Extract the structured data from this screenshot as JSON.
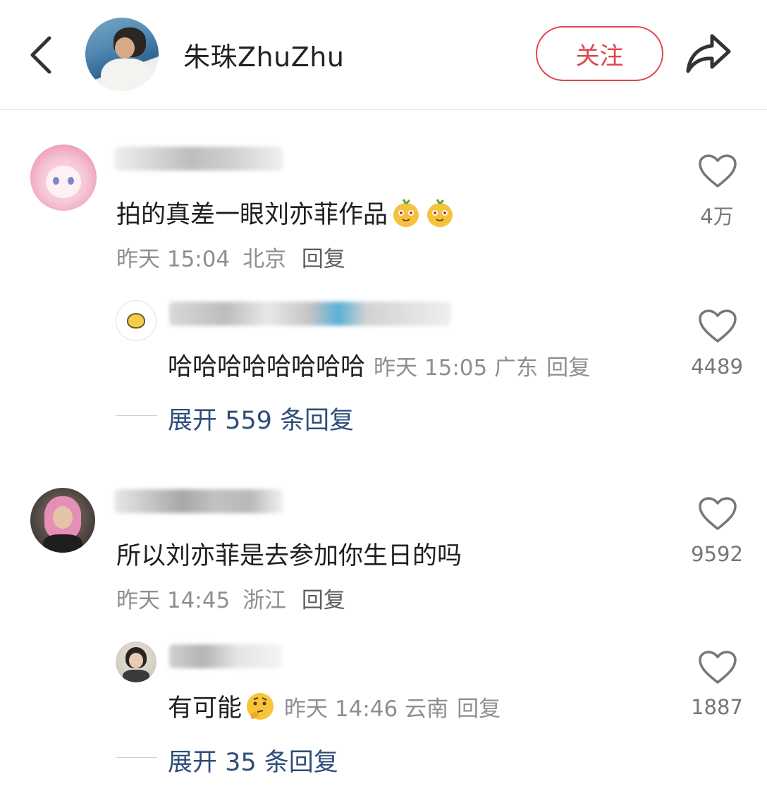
{
  "header": {
    "title": "朱珠ZhuZhu",
    "follow_label": "关注"
  },
  "comments": [
    {
      "text": "拍的真差一眼刘亦菲作品",
      "time": "昨天 15:04",
      "location": "北京",
      "reply_label": "回复",
      "likes": "4万",
      "replies": [
        {
          "text": "哈哈哈哈哈哈哈哈",
          "time": "昨天 15:05",
          "location": "广东",
          "reply_label": "回复",
          "likes": "4489"
        }
      ],
      "expand_label": "展开 559 条回复"
    },
    {
      "text": "所以刘亦菲是去参加你生日的吗",
      "time": "昨天 14:45",
      "location": "浙江",
      "reply_label": "回复",
      "likes": "9592",
      "replies": [
        {
          "text": "有可能",
          "time": "昨天 14:46",
          "location": "云南",
          "reply_label": "回复",
          "likes": "1887"
        }
      ],
      "expand_label": "展开 35 条回复"
    }
  ],
  "colors": {
    "accent": "#e0464f",
    "link": "#2e4d7a",
    "meta": "#8f8f8f"
  },
  "icons": [
    "back-arrow-icon",
    "share-icon",
    "heart-icon",
    "mango-emoji-icon",
    "thinking-face-emoji-icon"
  ]
}
